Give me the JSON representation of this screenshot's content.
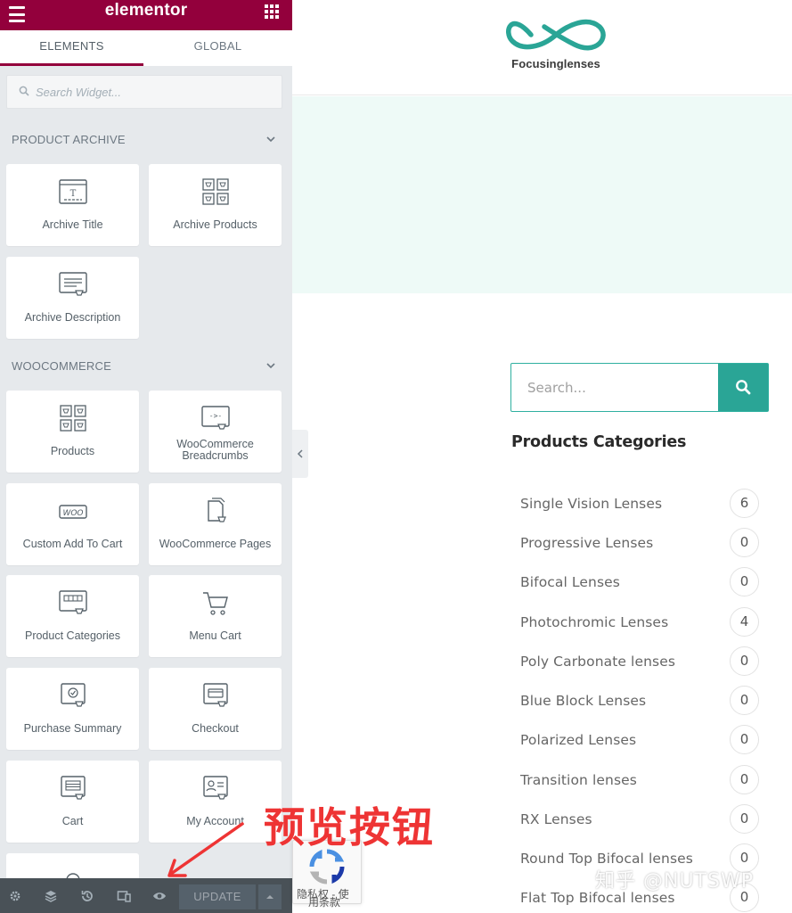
{
  "panel": {
    "brand": "elementor",
    "tabs": [
      {
        "label": "ELEMENTS",
        "active": true
      },
      {
        "label": "GLOBAL",
        "active": false
      }
    ],
    "search_placeholder": "Search Widget...",
    "sections": [
      {
        "title": "PRODUCT ARCHIVE"
      },
      {
        "title": "WOOCOMMERCE"
      }
    ],
    "widgets": [
      {
        "label": "Archive Title",
        "icon": "archive-title-icon"
      },
      {
        "label": "Archive Products",
        "icon": "archive-products-icon"
      },
      {
        "label": "Archive Description",
        "icon": "archive-description-icon"
      },
      {
        "label": "Products",
        "icon": "products-icon"
      },
      {
        "label": "WooCommerce Breadcrumbs",
        "icon": "breadcrumbs-icon"
      },
      {
        "label": "Custom Add To Cart",
        "icon": "woo-icon"
      },
      {
        "label": "WooCommerce Pages",
        "icon": "pages-icon"
      },
      {
        "label": "Product Categories",
        "icon": "product-categories-icon"
      },
      {
        "label": "Menu Cart",
        "icon": "cart-icon"
      },
      {
        "label": "Purchase Summary",
        "icon": "purchase-summary-icon"
      },
      {
        "label": "Checkout",
        "icon": "checkout-icon"
      },
      {
        "label": "Cart",
        "icon": "cart-widget-icon"
      },
      {
        "label": "My Account",
        "icon": "my-account-icon"
      }
    ],
    "footer": {
      "update_label": "UPDATE",
      "icons": [
        "settings-icon",
        "navigator-icon",
        "history-icon",
        "responsive-icon",
        "preview-eye-icon"
      ]
    },
    "colors": {
      "brand": "#93003c",
      "footer": "#495157",
      "panel_bg": "#e6e9ec"
    }
  },
  "site": {
    "logo_text": "Focusinglenses",
    "search_placeholder": "Search...",
    "categories_heading": "Products Categories",
    "categories": [
      {
        "name": "Single Vision Lenses",
        "count": "6"
      },
      {
        "name": "Progressive Lenses",
        "count": "0"
      },
      {
        "name": "Bifocal Lenses",
        "count": "0"
      },
      {
        "name": "Photochromic Lenses",
        "count": "4"
      },
      {
        "name": "Poly Carbonate lenses",
        "count": "0"
      },
      {
        "name": "Blue Block Lenses",
        "count": "0"
      },
      {
        "name": "Polarized Lenses",
        "count": "0"
      },
      {
        "name": "Transition lenses",
        "count": "0"
      },
      {
        "name": "RX Lenses",
        "count": "0"
      },
      {
        "name": "Round Top Bifocal lenses",
        "count": "0"
      },
      {
        "name": "Flat Top Bifocal lenses",
        "count": "0"
      }
    ],
    "colors": {
      "accent": "#2aa596",
      "hero_bg": "#eefaf7"
    }
  },
  "overlays": {
    "recaptcha_line1": "隐私权 - 使",
    "recaptcha_line2": "用条款",
    "annotation": "预览按钮",
    "watermark": "知乎 @NUTSWP",
    "annotation_color": "#ee3434"
  }
}
